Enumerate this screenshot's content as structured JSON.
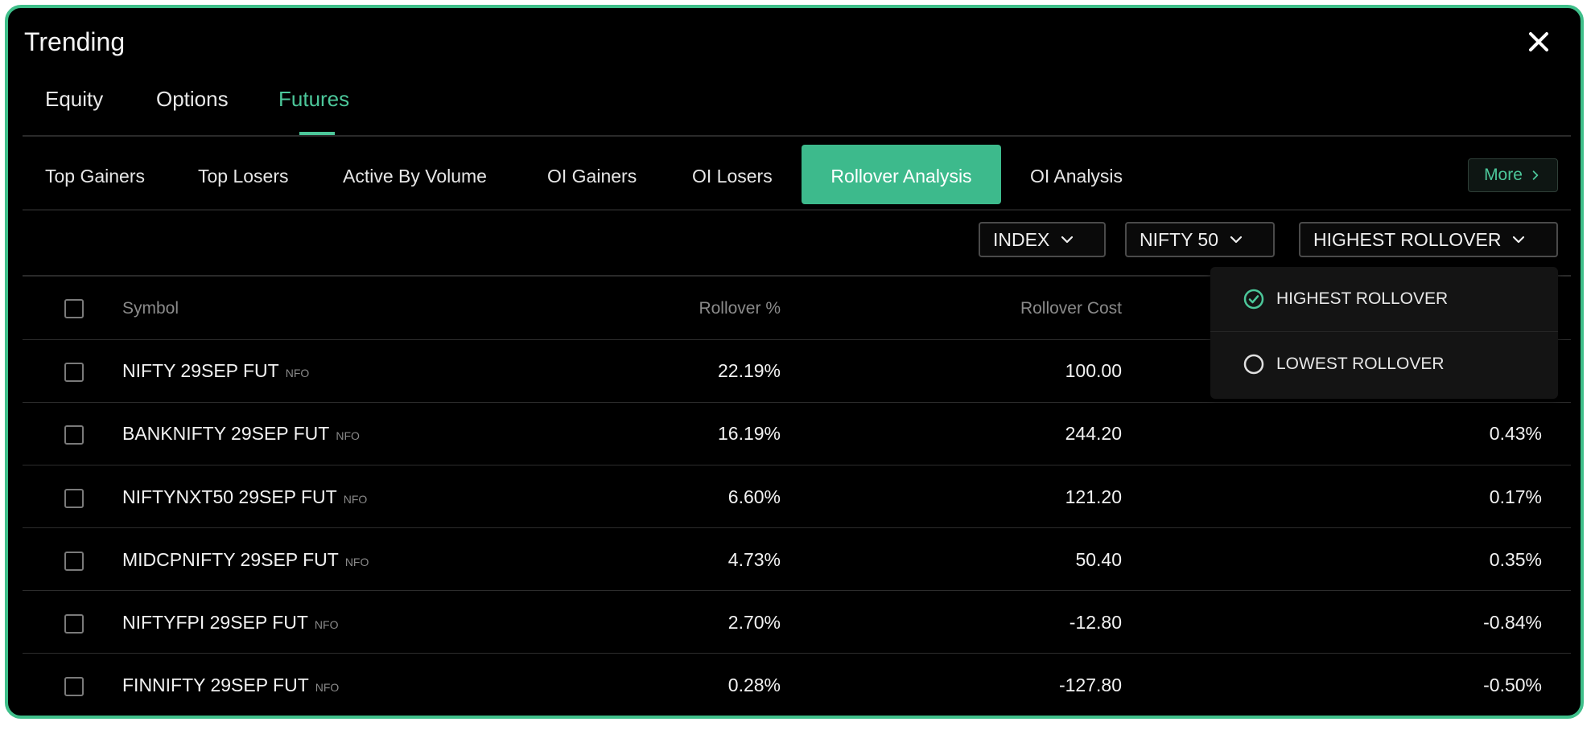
{
  "panel": {
    "title": "Trending"
  },
  "colors": {
    "accent": "#4cc79a",
    "active_tab_bg": "#3dba8c",
    "border": "#3fbf8a"
  },
  "icons": {
    "close": "close-icon",
    "chevron": "chevron-down-icon",
    "check": "check-circle-icon",
    "radio": "radio-empty-icon"
  },
  "main_tabs": [
    {
      "label": "Equity",
      "active": false
    },
    {
      "label": "Options",
      "active": false
    },
    {
      "label": "Futures",
      "active": true
    }
  ],
  "sub_tabs": [
    {
      "label": "Top Gainers"
    },
    {
      "label": "Top Losers"
    },
    {
      "label": "Active By Volume"
    },
    {
      "label": "OI Gainers"
    },
    {
      "label": "OI Losers"
    },
    {
      "label": "Rollover Analysis",
      "active": true
    },
    {
      "label": "OI Analysis"
    }
  ],
  "more": {
    "label": "More"
  },
  "filters": {
    "segment": "INDEX",
    "index": "NIFTY 50",
    "sort": "HIGHEST ROLLOVER"
  },
  "sort_menu": {
    "options": [
      {
        "label": "HIGHEST ROLLOVER",
        "selected": true
      },
      {
        "label": "LOWEST ROLLOVER",
        "selected": false
      }
    ]
  },
  "table": {
    "columns": {
      "symbol": "Symbol",
      "rollover_pct": "Rollover %",
      "rollover_cost": "Rollover Cost"
    },
    "rows": [
      {
        "symbol": "NIFTY 29SEP FUT",
        "exchange": "NFO",
        "rollover_pct": "22.19%",
        "rollover_cost": "100.00",
        "change": ""
      },
      {
        "symbol": "BANKNIFTY 29SEP FUT",
        "exchange": "NFO",
        "rollover_pct": "16.19%",
        "rollover_cost": "244.20",
        "change": "0.43%"
      },
      {
        "symbol": "NIFTYNXT50 29SEP FUT",
        "exchange": "NFO",
        "rollover_pct": "6.60%",
        "rollover_cost": "121.20",
        "change": "0.17%"
      },
      {
        "symbol": "MIDCPNIFTY 29SEP FUT",
        "exchange": "NFO",
        "rollover_pct": "4.73%",
        "rollover_cost": "50.40",
        "change": "0.35%"
      },
      {
        "symbol": "NIFTYFPI 29SEP FUT",
        "exchange": "NFO",
        "rollover_pct": "2.70%",
        "rollover_cost": "-12.80",
        "change": "-0.84%"
      },
      {
        "symbol": "FINNIFTY 29SEP FUT",
        "exchange": "NFO",
        "rollover_pct": "0.28%",
        "rollover_cost": "-127.80",
        "change": "-0.50%"
      }
    ]
  }
}
